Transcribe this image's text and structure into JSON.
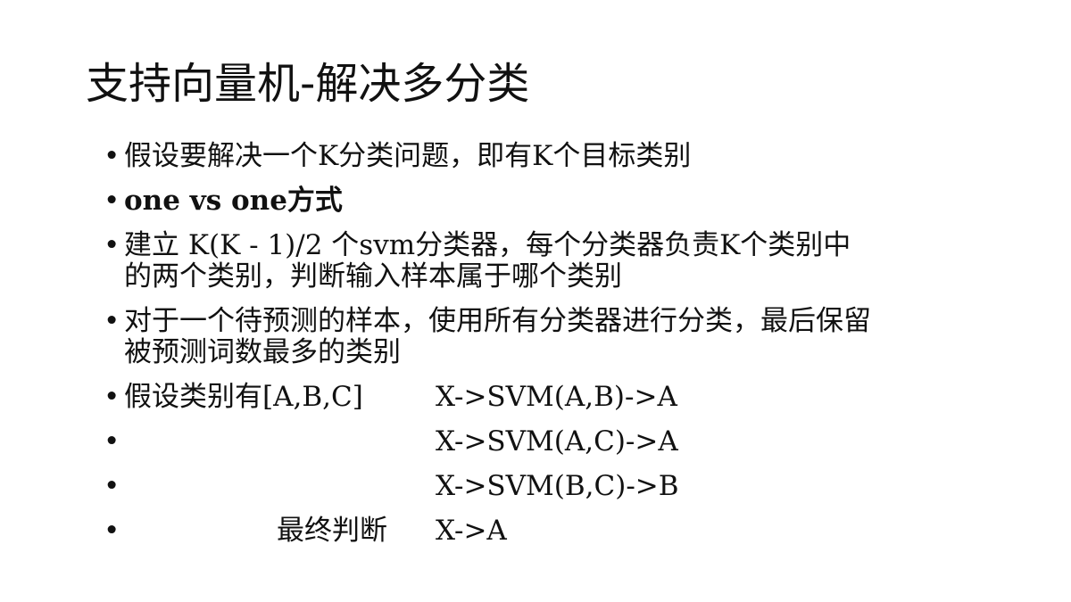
{
  "slide": {
    "title": "支持向量机-解决多分类",
    "bullets": [
      {
        "text": "假设要解决一个K分类问题，即有K个目标类别"
      },
      {
        "text": "one vs one方式"
      },
      {
        "text": "建立 K(K - 1)/2 个svm分类器，每个分类器负责K个类别中的两个类别，判断输入样本属于哪个类别"
      },
      {
        "text": "对于一个待预测的样本，使用所有分类器进行分类，最后保留被预测词数最多的类别"
      },
      {
        "label": "假设类别有[A,B,C]",
        "value": "X->SVM(A,B)->A"
      },
      {
        "label": "",
        "value": "X->SVM(A,C)->A"
      },
      {
        "label": "",
        "value": "X->SVM(B,C)->B"
      },
      {
        "label": "最终判断",
        "value": "X->A"
      }
    ],
    "bullet_glyph": "•"
  }
}
